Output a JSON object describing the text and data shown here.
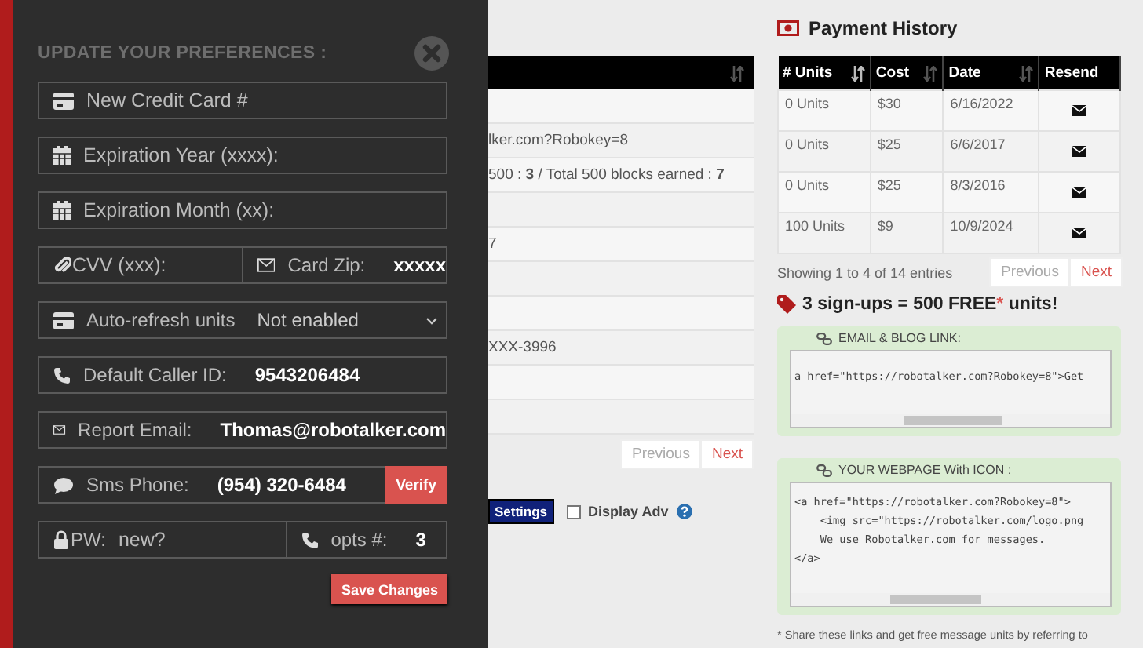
{
  "preferences": {
    "title": "UPDATE YOUR PREFERENCES :",
    "rows": [
      {
        "cells": [
          {
            "kind": "card",
            "placeholder": "New Credit Card #"
          }
        ]
      },
      {
        "cells": [
          {
            "kind": "year",
            "placeholder": "Expiration Year (xxxx):"
          }
        ]
      },
      {
        "cells": [
          {
            "kind": "month",
            "placeholder": "Expiration Month (xx):"
          }
        ]
      },
      {
        "cells": [
          {
            "kind": "cvv",
            "placeholder": "CVV (xxx):"
          },
          {
            "kind": "zip",
            "label": "Card Zip:",
            "value": "xxxxx"
          }
        ]
      },
      {
        "cells": [
          {
            "kind": "autorefresh",
            "label": "Auto-refresh units",
            "value": "Not enabled"
          }
        ]
      },
      {
        "cells": [
          {
            "kind": "caller",
            "label": "Default Caller ID:",
            "value": "9543206484"
          }
        ]
      },
      {
        "cells": [
          {
            "kind": "email",
            "label": "Report Email:",
            "value": "Thomas@robotalker.com"
          }
        ]
      },
      {
        "cells": [
          {
            "kind": "sms",
            "label": "Sms Phone:",
            "value": "(954) 320-6484",
            "button": "Verify"
          }
        ]
      },
      {
        "cells": [
          {
            "kind": "password",
            "label": "PW:",
            "placeholder": "new?"
          },
          {
            "kind": "opts",
            "label": "opts #:",
            "value": "3"
          }
        ]
      }
    ],
    "save": "Save Changes"
  },
  "referrals": {
    "rows": [
      {},
      {
        "text": "lker.com?Robokey=8"
      },
      {
        "text": "500 : **3** / Total 500 blocks earned : **7**"
      },
      {},
      {
        "text": "7"
      },
      {},
      {},
      {
        "text": "XXX-3996"
      },
      {},
      {}
    ],
    "pagination": [
      {
        "label": "Previous",
        "disabled": true
      },
      {
        "label": "Next",
        "disabled": false
      }
    ],
    "settings_button": "Settings",
    "display_adv": {
      "label": "Display Adv",
      "checked": false
    }
  },
  "payment_history": {
    "title": "Payment History",
    "columns": [
      {
        "label": "# Units",
        "sorted": true
      },
      {
        "label": "Cost",
        "sorted": false
      },
      {
        "label": "Date",
        "sorted": false
      },
      {
        "label": "Resend"
      }
    ],
    "rows": [
      {
        "units": "0 Units",
        "cost": "$30",
        "date": "6/16/2022"
      },
      {
        "units": "0 Units",
        "cost": "$25",
        "date": "6/6/2017"
      },
      {
        "units": "0 Units",
        "cost": "$25",
        "date": "8/3/2016"
      },
      {
        "units": "100 Units",
        "cost": "$9",
        "date": "10/9/2024"
      }
    ],
    "info": "Showing 1 to 4 of 14 entries",
    "pagination": [
      {
        "label": "Previous",
        "disabled": true
      },
      {
        "label": "Next",
        "disabled": false
      }
    ]
  },
  "promo": {
    "before": "3 sign-ups = 500 FREE",
    "mark": "*",
    "after": " units!"
  },
  "link_boxes": [
    {
      "title": "EMAIL & BLOG LINK:",
      "code": "a href=\"https://robotalker.com?Robokey=8\">Get"
    },
    {
      "title": "YOUR WEBPAGE With ICON :",
      "code": "<a href=\"https://robotalker.com?Robokey=8\">\n    <img src=\"https://robotalker.com/logo.png\n    We use Robotalker.com for messages.\n</a>"
    }
  ],
  "footnote": "* Share these links and get free message units by referring to"
}
